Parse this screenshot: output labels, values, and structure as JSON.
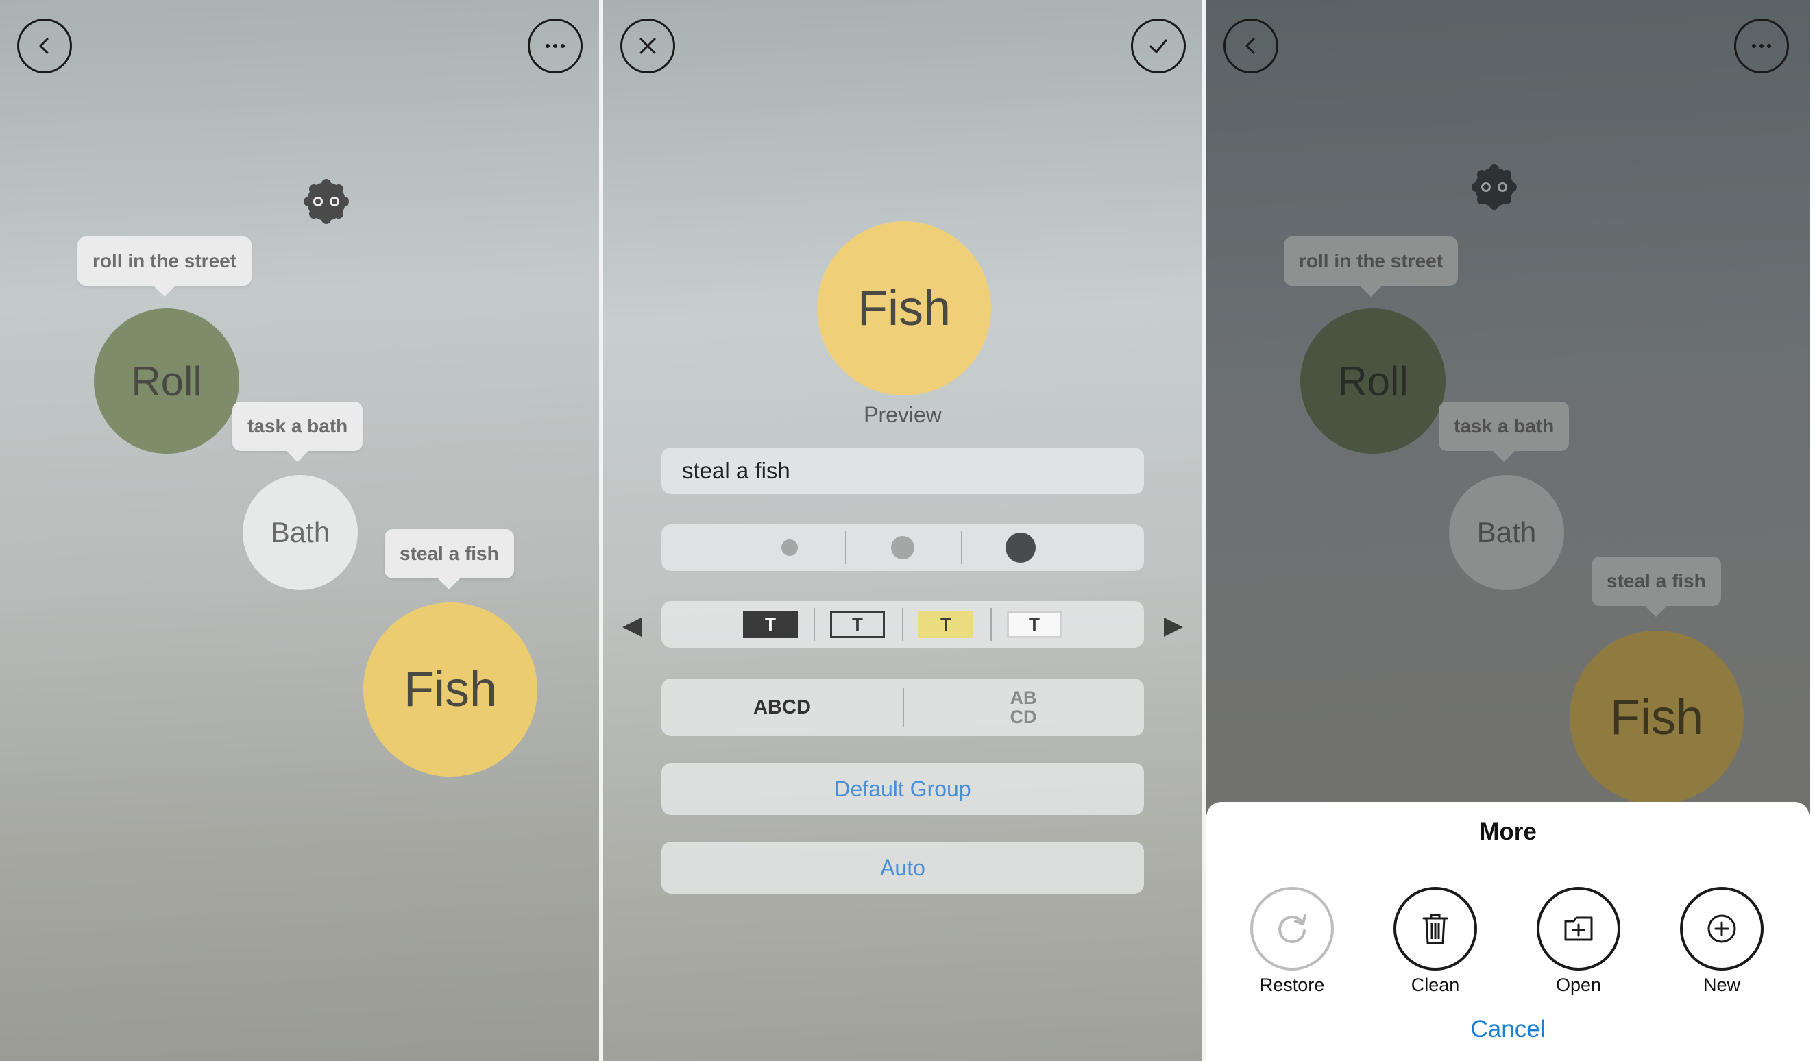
{
  "panel_1": {
    "nodes": [
      {
        "label": "Roll",
        "tooltip": "roll in the street",
        "color": "#7d8d6a"
      },
      {
        "label": "Bath",
        "tooltip": "task a bath",
        "color": "#e7e8e8"
      },
      {
        "label": "Fish",
        "tooltip": "steal a fish",
        "color": "#ebcc70"
      }
    ],
    "icons": {
      "back": "chevron-left-icon",
      "more": "ellipsis-icon",
      "creature": "soot-sprite-icon"
    }
  },
  "panel_2": {
    "preview_bubble": {
      "label": "Fish",
      "color": "#efcf77"
    },
    "preview_caption": "Preview",
    "text_input_value": "steal a fish",
    "size_options": [
      "small",
      "medium",
      "large"
    ],
    "style_options": [
      "T",
      "T",
      "T",
      "T"
    ],
    "layout_options": {
      "single_line": "ABCD",
      "multi_line_1": "AB",
      "multi_line_2": "CD"
    },
    "group_button": "Default Group",
    "auto_button": "Auto",
    "icons": {
      "cancel": "close-icon",
      "confirm": "checkmark-icon",
      "prev": "triangle-left-icon",
      "next": "triangle-right-icon"
    },
    "link_color": "#4a8fd6"
  },
  "panel_3": {
    "nodes": [
      {
        "label": "Roll",
        "tooltip": "roll in the street",
        "color": "#4a5541"
      },
      {
        "label": "Bath",
        "tooltip": "task a bath",
        "color": "#8c8e8d"
      },
      {
        "label": "Fish",
        "tooltip": "steal a fish",
        "color": "#8f7a3f"
      }
    ],
    "sheet": {
      "title": "More",
      "actions": [
        {
          "label": "Restore",
          "icon": "restore-icon"
        },
        {
          "label": "Clean",
          "icon": "trash-icon"
        },
        {
          "label": "Open",
          "icon": "folder-add-icon"
        },
        {
          "label": "New",
          "icon": "plus-icon"
        }
      ],
      "cancel": "Cancel",
      "cancel_color": "#1a7fd6"
    }
  }
}
